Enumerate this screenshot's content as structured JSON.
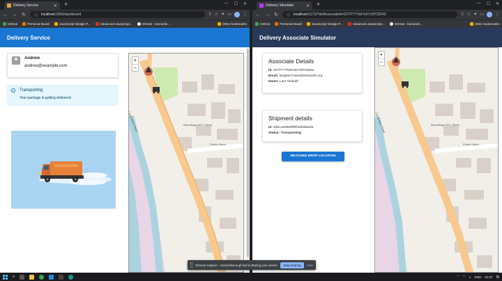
{
  "left_window": {
    "tab_title": "Delivery Service",
    "url_host": "localhost",
    "url_rest": ":3000/dashboard",
    "app_title": "Delivery Service",
    "user": {
      "name": "Andrew",
      "email": "andrew@example.com"
    },
    "status": {
      "title": "Transporting",
      "message": "Your package is getting delivered"
    }
  },
  "right_window": {
    "tab_title": "Delivery Simulator",
    "url_host": "localhost",
    "url_rest": ":5173/?delAssociateId=627f7777b67e67c0f732542",
    "app_title": "Delivery Associate Simulator",
    "associate": {
      "title": "Associate Details",
      "id_label": "Id:",
      "id_value": "627f7777b67e67c0f732542",
      "email_label": "Email:",
      "email_value": "bingbed.haira@eshworth.org",
      "name_label": "Name:",
      "name_value": "Lars Seibold"
    },
    "shipment": {
      "title": "Shipment details",
      "id_label": "Id:",
      "id_value": "630c15695f8ff9f45f99da29",
      "status_label": "Status:",
      "status_value": "Transporting"
    },
    "reached_button": "REACHED DROP LOCATION"
  },
  "bookmarks": [
    {
      "label": "GDrive",
      "color": "#34a853"
    },
    {
      "label": "Personal Board",
      "color": "#e8710a"
    },
    {
      "label": "JavaScript Design P...",
      "color": "#f9ab00"
    },
    {
      "label": "Advanced Javascript...",
      "color": "#d93025"
    },
    {
      "label": "GitHub - leonardo...",
      "color": "#e8eaed"
    }
  ],
  "other_bookmarks": "Other bookmarks",
  "map": {
    "street_label": "Pinkle Street",
    "area_label": "Branvillage NTC Street",
    "road_label": "Canal Bank Road",
    "zoom_in": "+",
    "zoom_out": "−"
  },
  "screen_share": {
    "message": "Chrome Capture - screenshot & gif tool is sharing your screen.",
    "stop_label": "Stop sharing",
    "hide_label": "Hide"
  },
  "taskbar": {
    "time": "01:57",
    "lang": "ENG"
  },
  "colors": {
    "left_header": "#1976d2",
    "right_header": "#283a5b",
    "alert_bg": "#e5f6fd",
    "button": "#1976d2"
  }
}
